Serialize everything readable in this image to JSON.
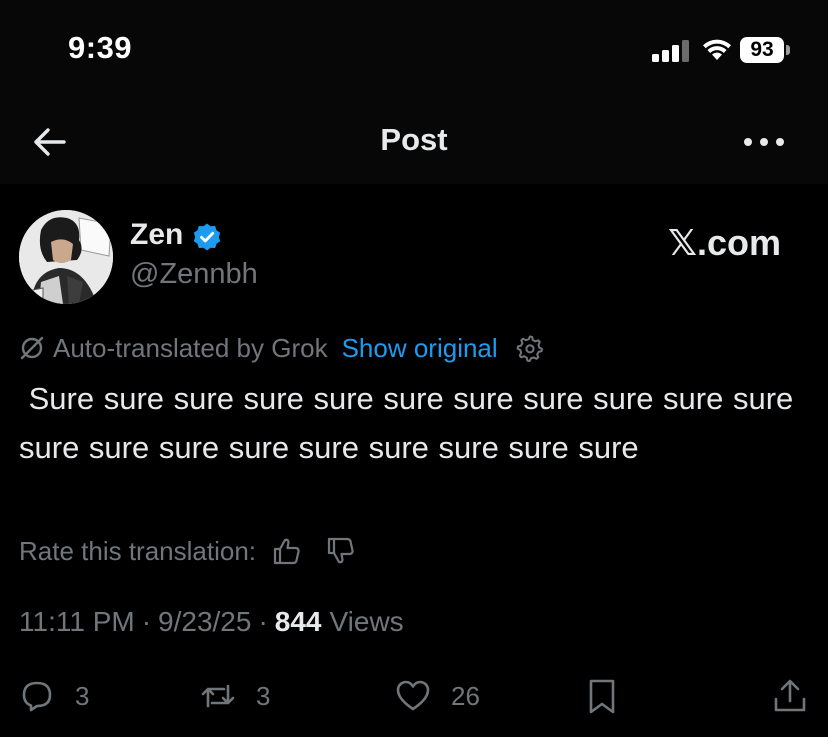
{
  "status_bar": {
    "time": "9:39",
    "battery_level": "93"
  },
  "nav": {
    "title": "Post"
  },
  "author": {
    "name": "Zen",
    "handle": "@Zennbh",
    "verified": true,
    "watermark": "𝕏.com"
  },
  "translation": {
    "label": "Auto-translated by Grok",
    "show_original": "Show original"
  },
  "tweet": {
    "text": " Sure sure sure sure sure sure sure sure sure sure sure sure sure sure sure sure sure sure sure sure"
  },
  "rate": {
    "label": "Rate this translation:"
  },
  "meta": {
    "time": "11:11 PM",
    "date": "9/23/25",
    "sep": "·",
    "views_count": "844",
    "views_label": "Views"
  },
  "actions": {
    "replies": "3",
    "reposts": "3",
    "likes": "26"
  },
  "colors": {
    "background": "#000000",
    "text": "#e7e9ea",
    "muted": "#71767b",
    "link": "#1d9bf0",
    "verified": "#1d9bf0"
  }
}
